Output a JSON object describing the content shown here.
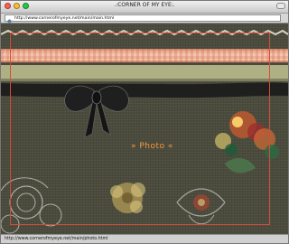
{
  "window": {
    "title": ".:CORNER OF MY EYE:."
  },
  "address_bar": {
    "url": "http://www.cornerofmyeye.net/main/main.html"
  },
  "content": {
    "nav_link": "» Photo «"
  },
  "status_bar": {
    "text": "http://www.cornerofmyeye.net/main/photo.html"
  },
  "colors": {
    "background": "#4b4b3d",
    "frame": "#d84a3a",
    "link": "#f39a3a",
    "ribbon_light": "#f2c6ae",
    "ribbon_green": "#b9bb8c",
    "bow": "#1c1c1c"
  }
}
